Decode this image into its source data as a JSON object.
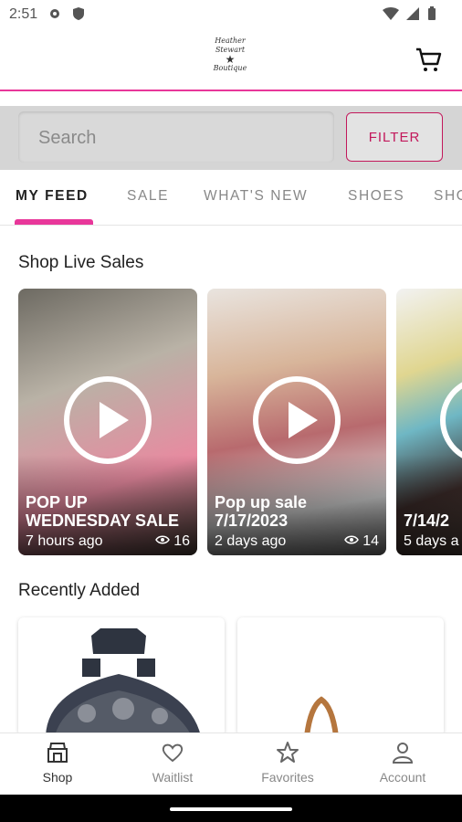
{
  "status_bar": {
    "time": "2:51"
  },
  "header": {
    "logo_line1": "Heather Stewart",
    "logo_line2": "Boutique"
  },
  "search": {
    "placeholder": "Search",
    "filter_label": "FILTER"
  },
  "tabs": [
    "MY FEED",
    "SALE",
    "WHAT'S NEW",
    "SHOES",
    "SHO"
  ],
  "sections": {
    "live": "Shop Live Sales",
    "recent": "Recently Added"
  },
  "live_cards": [
    {
      "title": "POP UP WEDNESDAY SALE",
      "time": "7 hours ago",
      "views": "16"
    },
    {
      "title": "Pop up sale 7/17/2023",
      "time": "2 days ago",
      "views": "14"
    },
    {
      "title": "7/14/2",
      "time": "5 days a",
      "views": ""
    }
  ],
  "bottom_nav": [
    {
      "label": "Shop",
      "icon": "shop-icon"
    },
    {
      "label": "Waitlist",
      "icon": "heart-icon"
    },
    {
      "label": "Favorites",
      "icon": "star-icon"
    },
    {
      "label": "Account",
      "icon": "person-icon"
    }
  ],
  "colors": {
    "accent": "#e8379a",
    "filter": "#c2185b"
  }
}
